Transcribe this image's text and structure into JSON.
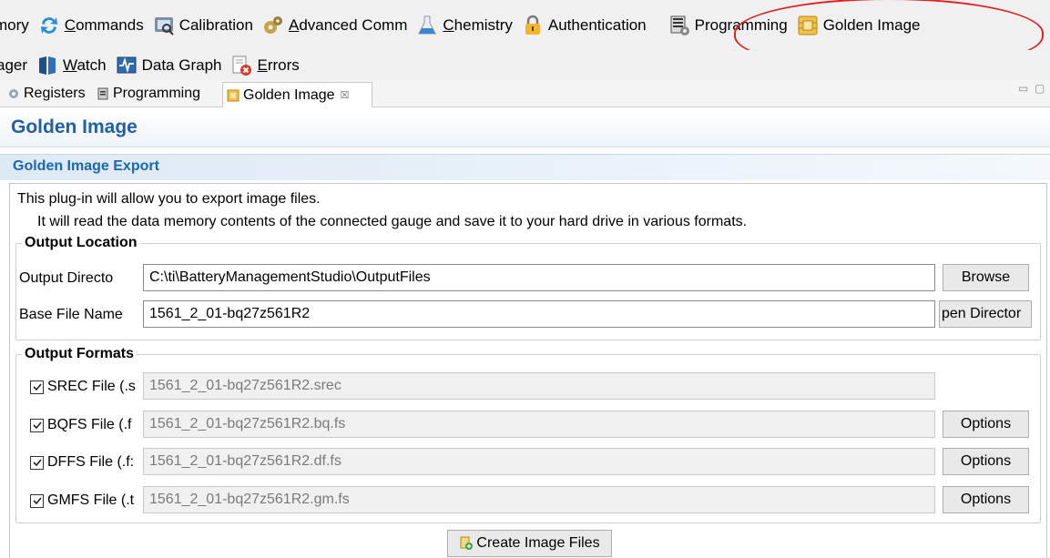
{
  "toolbar_row1": [
    {
      "name": "memory",
      "label": "mory",
      "icon": "memory-icon"
    },
    {
      "name": "commands",
      "label": "Commands",
      "mnemonic": "C",
      "icon": "refresh-arrows-icon"
    },
    {
      "name": "calibration",
      "label": "Calibration",
      "icon": "calibration-icon"
    },
    {
      "name": "advanced-comm",
      "label": "Advanced Comm",
      "mnemonic": "A",
      "icon": "gears-icon"
    },
    {
      "name": "chemistry",
      "label": "Chemistry",
      "mnemonic": "C",
      "icon": "flask-icon"
    },
    {
      "name": "authentication",
      "label": "Authentication",
      "icon": "padlock-icon"
    },
    {
      "name": "programming",
      "label": "Programming",
      "icon": "programming-icon"
    },
    {
      "name": "golden-image",
      "label": "Golden Image",
      "icon": "chip-icon"
    }
  ],
  "toolbar_row2": [
    {
      "name": "manager",
      "label": "ager",
      "icon": "manager-icon"
    },
    {
      "name": "watch",
      "label": "Watch",
      "mnemonic": "W",
      "icon": "book-icon"
    },
    {
      "name": "data-graph",
      "label": "Data Graph",
      "icon": "graph-icon"
    },
    {
      "name": "errors",
      "label": "Errors",
      "mnemonic": "E",
      "icon": "error-icon"
    }
  ],
  "tabs": [
    {
      "label": "Registers"
    },
    {
      "label": "Programming"
    },
    {
      "label": "Golden Image",
      "close": "☒"
    }
  ],
  "window_controls": {
    "minimize": "▭",
    "maximize": "▢"
  },
  "page": {
    "title": "Golden Image"
  },
  "section": {
    "title": "Golden Image Export",
    "description_1": "This plug-in will allow you to export image files.",
    "description_2": "It will read the data memory contents of the connected gauge and save it to your hard drive in various formats."
  },
  "output_location": {
    "legend": "Output Location",
    "directory_label": "Output Directo",
    "directory_value": "C:\\ti\\BatteryManagementStudio\\OutputFiles",
    "browse_label": "Browse",
    "base_name_label": "Base File Name",
    "base_name_value": "1561_2_01-bq27z561R2",
    "open_dir_label": "pen Director"
  },
  "output_formats": {
    "legend": "Output Formats",
    "rows": [
      {
        "label": "SREC File (.s",
        "value": "1561_2_01-bq27z561R2.srec",
        "checked": true,
        "options": ""
      },
      {
        "label": "BQFS File (.f",
        "value": "1561_2_01-bq27z561R2.bq.fs",
        "checked": true,
        "options": "Options"
      },
      {
        "label": "DFFS File (.f:",
        "value": "1561_2_01-bq27z561R2.df.fs",
        "checked": true,
        "options": "Options"
      },
      {
        "label": "GMFS File (.t",
        "value": "1561_2_01-bq27z561R2.gm.fs",
        "checked": true,
        "options": "Options"
      }
    ]
  },
  "create_button": {
    "label": "Create Image Files",
    "icon": "create-files-icon"
  },
  "colors": {
    "title_blue": "#215fa6",
    "section_blue": "#1b66b5",
    "highlight": "#e02020"
  }
}
